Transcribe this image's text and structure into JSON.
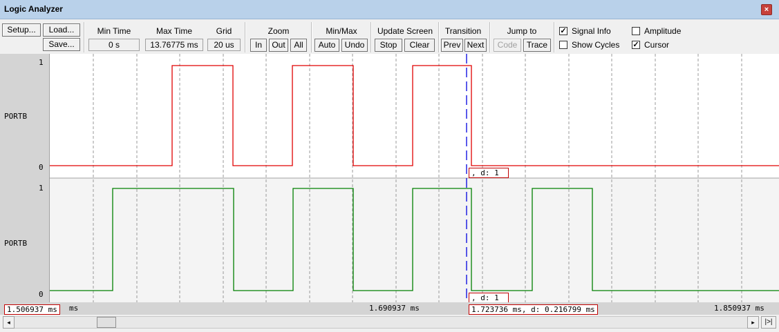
{
  "window": {
    "title": "Logic Analyzer",
    "close_label": "×"
  },
  "toolbar": {
    "setup": "Setup...",
    "load": "Load...",
    "save": "Save...",
    "min_time": {
      "label": "Min Time",
      "value": "0 s"
    },
    "max_time": {
      "label": "Max Time",
      "value": "13.76775 ms"
    },
    "grid": {
      "label": "Grid",
      "value": "20 us"
    },
    "zoom": {
      "label": "Zoom",
      "in": "In",
      "out": "Out",
      "all": "All"
    },
    "minmax": {
      "label": "Min/Max",
      "auto": "Auto",
      "undo": "Undo"
    },
    "update": {
      "label": "Update Screen",
      "stop": "Stop",
      "clear": "Clear"
    },
    "transition": {
      "label": "Transition",
      "prev": "Prev",
      "next": "Next"
    },
    "jump": {
      "label": "Jump to",
      "code": "Code",
      "trace": "Trace"
    },
    "options": {
      "signal_info": {
        "label": "Signal Info",
        "checked": true
      },
      "amplitude": {
        "label": "Amplitude",
        "checked": false
      },
      "show_cycles": {
        "label": "Show Cycles",
        "checked": false
      },
      "cursor": {
        "label": "Cursor",
        "checked": true
      }
    }
  },
  "signals": [
    {
      "name": "PORTB",
      "high_label": "1",
      "low_label": "0",
      "color": "#e00000"
    },
    {
      "name": "PORTB",
      "high_label": "1",
      "low_label": "0",
      "color": "#008000"
    }
  ],
  "cursor_color": "#0000e0",
  "cursor_boxes": {
    "signal1": ",  d: 1",
    "signal2": ",  d: 1"
  },
  "time_axis": {
    "left_box": "1.506937 ms",
    "left_unit": "ms",
    "mid": "1.690937 ms",
    "cursor_box": "1.723736 ms,   d: 0.216799 ms",
    "right": "1.850937 ms"
  },
  "scroll": {
    "left_arrow": "◂",
    "right_arrow": "▸",
    "end_button": "|>|"
  }
}
